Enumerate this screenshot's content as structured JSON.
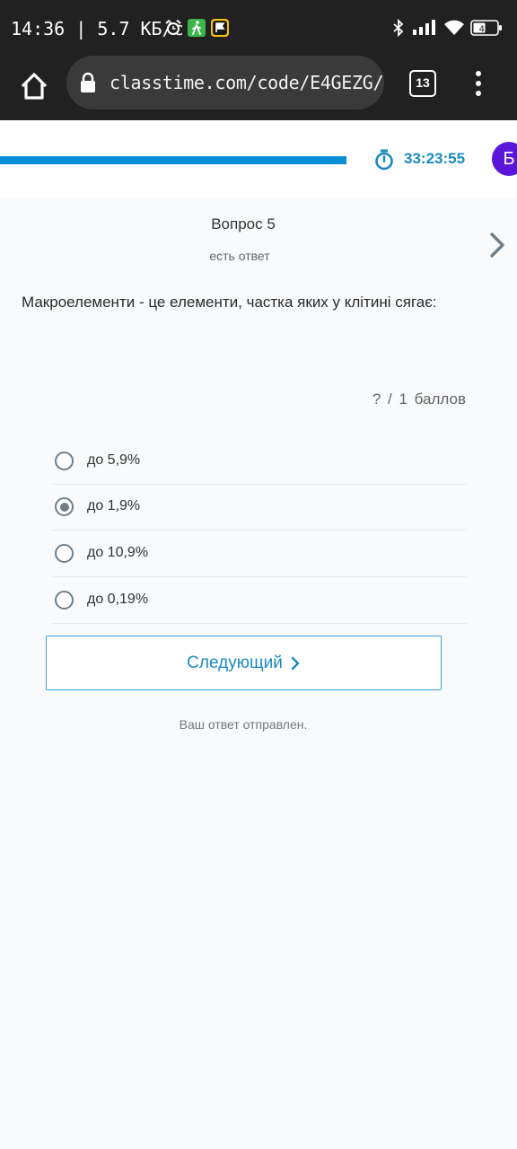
{
  "status_bar": {
    "time_speed": "14:36 | 5.7 КБ/с",
    "battery": "46",
    "icons": [
      "alarm-icon",
      "walking-icon",
      "flag-icon",
      "bluetooth-icon",
      "signal-icon",
      "wifi-icon",
      "battery-icon"
    ]
  },
  "browser": {
    "url": "classtime.com/code/E4GEZG/",
    "tab_count": "13"
  },
  "header": {
    "progress_fraction": 0.67,
    "timer": "33:23:55",
    "avatar_letter": "Б",
    "accent_color": "#0a8fd6",
    "avatar_color": "#5b16dc"
  },
  "question": {
    "title": "Вопрос 5",
    "status": "есть ответ",
    "text": "Макроелементи - це елементи, частка яких у клітині сягає:",
    "points": "?  /  1  баллов",
    "options": [
      {
        "label": "до 5,9%",
        "selected": false
      },
      {
        "label": "до 1,9%",
        "selected": true
      },
      {
        "label": "до 10,9%",
        "selected": false
      },
      {
        "label": "до 0,19%",
        "selected": false
      }
    ],
    "next_button": "Следующий",
    "sent_message": "Ваш ответ отправлен."
  }
}
